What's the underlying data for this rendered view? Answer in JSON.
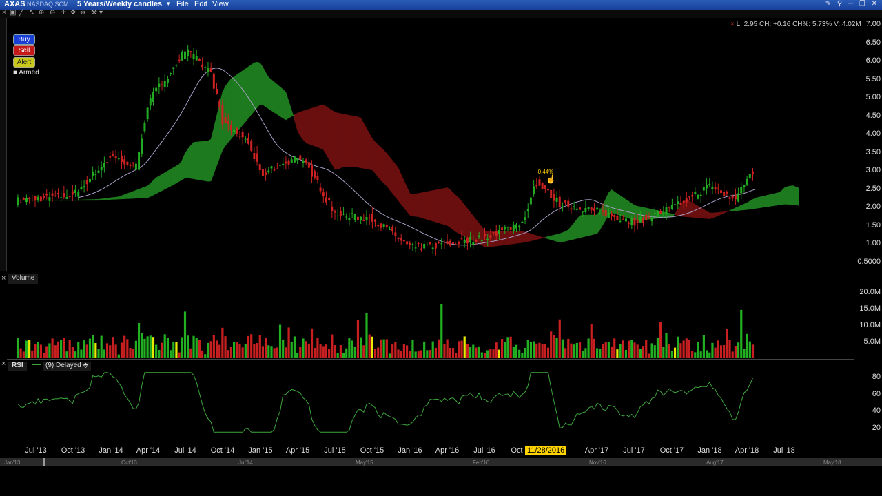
{
  "titlebar": {
    "symbol": "AXAS",
    "exchange": "NASDAQ.SCM",
    "period": "5 Years/Weekly candles",
    "menu": [
      "File",
      "Edit",
      "View"
    ]
  },
  "info_line": "L: 2.95 CH: +0.16 CH%: 5.73% V: 4.02M",
  "buttons": {
    "buy": "Buy",
    "sell": "Sell",
    "alert": "Alert",
    "armed": "Armed"
  },
  "price_axis": [
    "7.00",
    "6.50",
    "6.00",
    "5.50",
    "5.00",
    "4.50",
    "4.00",
    "3.50",
    "3.00",
    "2.50",
    "2.00",
    "1.50",
    "1.00",
    "0.5000"
  ],
  "volume_panel": {
    "label": "Volume",
    "axis": [
      "20.0M",
      "15.0M",
      "10.0M",
      "5.0M"
    ]
  },
  "rsi_panel": {
    "label": "RSI",
    "legend": "(9) Delayed",
    "axis": [
      "80",
      "60",
      "40",
      "20"
    ]
  },
  "time_axis": [
    "Jul '13",
    "Oct '13",
    "Jan '14",
    "Apr '14",
    "Jul '14",
    "Oct '14",
    "Jan '15",
    "Apr '15",
    "Jul '15",
    "Oct '15",
    "Jan '16",
    "Apr '16",
    "Jul '16",
    "Oct",
    "Apr '17",
    "Jul '17",
    "Oct '17",
    "Jan '18",
    "Apr '18",
    "Jul '18"
  ],
  "cursor": {
    "date_label": "11/28/2016",
    "delta_label": "-0.44%"
  },
  "scroll_axis": [
    "Jan'13",
    "Oct'13",
    "Jul'14",
    "May'15",
    "Feb'16",
    "Nov'16",
    "Aug'17",
    "May'18"
  ],
  "colors": {
    "up": "#22aa22",
    "down": "#cc2222",
    "cloud_up": "#1e7a1e",
    "cloud_down": "#6a0f0f",
    "ma": "#a9a0c8",
    "rsi": "#3ea83e",
    "cursor_label": "#ffd200"
  },
  "chart_data": {
    "type": "candlestick",
    "title": "AXAS NASDAQ.SCM 5 Years/Weekly candles",
    "ylim": [
      0.5,
      7.0
    ],
    "close_trajectory": [
      [
        "Jun '13",
        2.2
      ],
      [
        "Jul '13",
        2.25
      ],
      [
        "Oct '13",
        2.35
      ],
      [
        "Jan '14",
        3.4
      ],
      [
        "Mar '14",
        3.1
      ],
      [
        "Apr '14",
        4.9
      ],
      [
        "Jul '14",
        6.3
      ],
      [
        "Sep '14",
        5.7
      ],
      [
        "Oct '14",
        4.3
      ],
      [
        "Dec '14",
        3.8
      ],
      [
        "Jan '15",
        2.9
      ],
      [
        "Apr '15",
        3.4
      ],
      [
        "May '15",
        3.0
      ],
      [
        "Jul '15",
        1.8
      ],
      [
        "Oct '15",
        1.7
      ],
      [
        "Jan '16",
        0.9
      ],
      [
        "Apr '16",
        1.0
      ],
      [
        "Jul '16",
        1.2
      ],
      [
        "Oct '16",
        1.6
      ],
      [
        "Nov '16",
        2.7
      ],
      [
        "Jan '17",
        2.1
      ],
      [
        "Apr '17",
        1.9
      ],
      [
        "Jul '17",
        1.6
      ],
      [
        "Oct '17",
        2.0
      ],
      [
        "Jan '18",
        2.6
      ],
      [
        "Mar '18",
        2.2
      ],
      [
        "Apr '18",
        2.9
      ]
    ],
    "volume_peak_labels": [
      "20.0M",
      "15.0M",
      "10.0M",
      "5.0M"
    ],
    "rsi_range": [
      15,
      85
    ]
  }
}
